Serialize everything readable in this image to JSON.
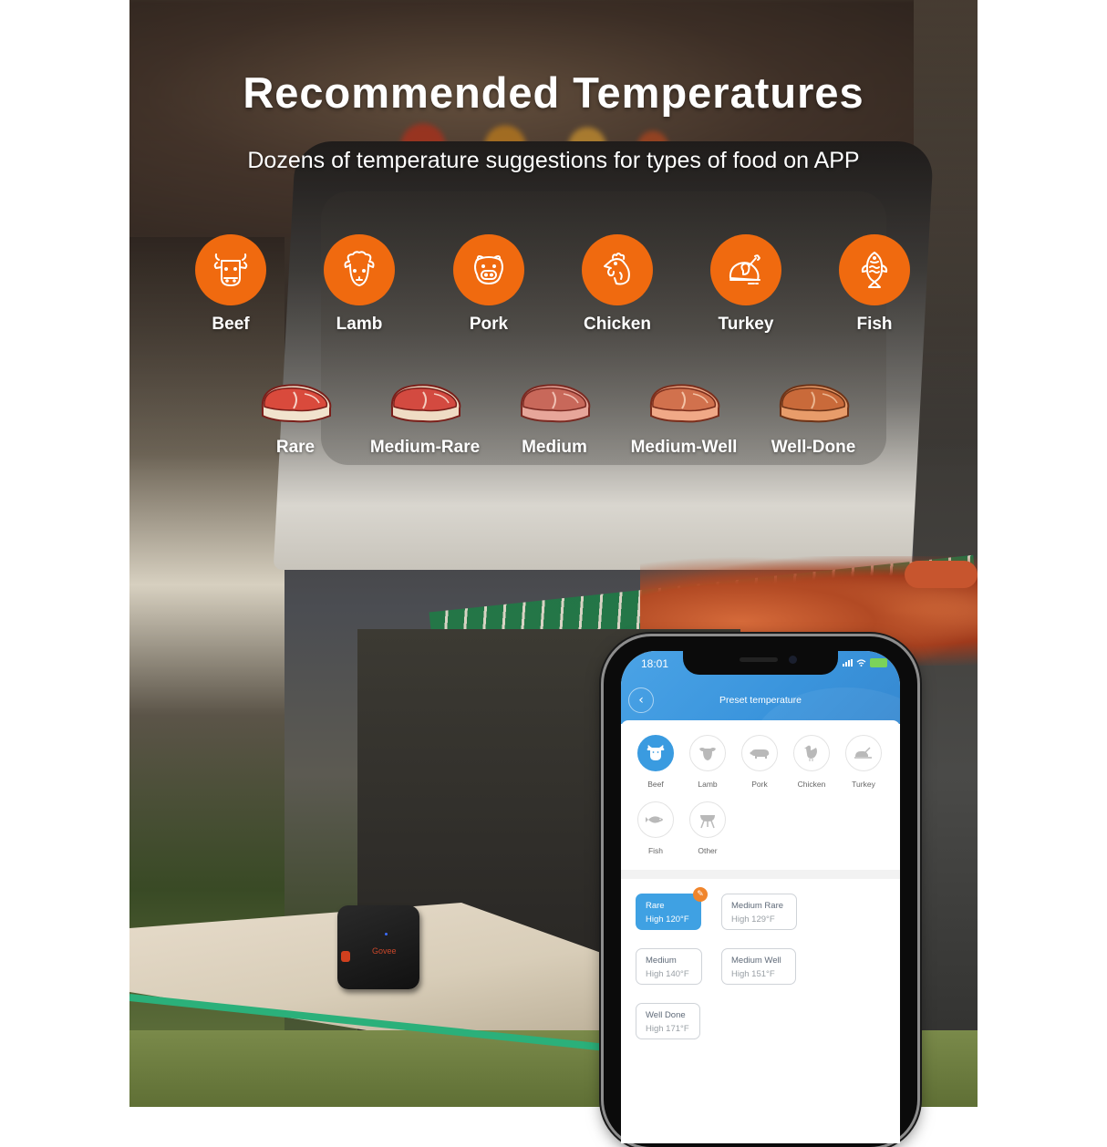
{
  "banner": {
    "title": "Recommended Temperatures",
    "subtitle": "Dozens of temperature suggestions for types of food on APP",
    "accent_color": "#f06a0f"
  },
  "food_types": [
    {
      "label": "Beef",
      "icon": "cow-head-icon"
    },
    {
      "label": "Lamb",
      "icon": "sheep-head-icon"
    },
    {
      "label": "Pork",
      "icon": "pig-head-icon"
    },
    {
      "label": "Chicken",
      "icon": "chicken-head-icon"
    },
    {
      "label": "Turkey",
      "icon": "roast-turkey-icon"
    },
    {
      "label": "Fish",
      "icon": "fish-icon"
    }
  ],
  "doneness_levels": [
    {
      "label": "Rare",
      "color": "#d94a3c"
    },
    {
      "label": "Medium-Rare",
      "color": "#d34a40"
    },
    {
      "label": "Medium",
      "color": "#c8685a"
    },
    {
      "label": "Medium-Well",
      "color": "#d1714d"
    },
    {
      "label": "Well-Done",
      "color": "#c96a3a"
    }
  ],
  "device": {
    "brand": "Govee"
  },
  "phone": {
    "status_bar": {
      "time": "18:01"
    },
    "app": {
      "title": "Preset temperature",
      "categories": [
        {
          "label": "Beef",
          "icon": "cow-icon",
          "selected": true
        },
        {
          "label": "Lamb",
          "icon": "sheep-icon",
          "selected": false
        },
        {
          "label": "Pork",
          "icon": "pig-icon",
          "selected": false
        },
        {
          "label": "Chicken",
          "icon": "chicken-icon",
          "selected": false
        },
        {
          "label": "Turkey",
          "icon": "turkey-icon",
          "selected": false
        },
        {
          "label": "Fish",
          "icon": "fish-icon",
          "selected": false
        },
        {
          "label": "Other",
          "icon": "grill-icon",
          "selected": false
        }
      ],
      "presets": [
        {
          "name": "Rare",
          "temp": "High 120°F",
          "selected": true
        },
        {
          "name": "Medium Rare",
          "temp": "High 129°F",
          "selected": false
        },
        {
          "name": "Medium",
          "temp": "High 140°F",
          "selected": false
        },
        {
          "name": "Medium Well",
          "temp": "High 151°F",
          "selected": false
        },
        {
          "name": "Well Done",
          "temp": "High 171°F",
          "selected": false
        }
      ],
      "accent_color": "#3a9be0",
      "edit_badge_color": "#f0852c"
    }
  }
}
